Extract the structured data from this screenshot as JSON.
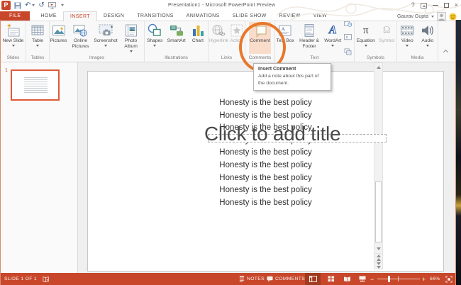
{
  "window": {
    "title": "Presentation1 - Microsoft PowerPoint Preview",
    "help_glyph": "?",
    "close_glyph": "×",
    "account_name": "Gaurav Gupta"
  },
  "tabs": [
    {
      "label": "FILE",
      "file": true
    },
    {
      "label": "HOME"
    },
    {
      "label": "INSERT",
      "active": true
    },
    {
      "label": "DESIGN"
    },
    {
      "label": "TRANSITIONS"
    },
    {
      "label": "ANIMATIONS"
    },
    {
      "label": "SLIDE SHOW"
    },
    {
      "label": "REVIEW"
    },
    {
      "label": "VIEW"
    }
  ],
  "ribbon": {
    "groups": [
      {
        "label": "Slides",
        "buttons": [
          {
            "label": "New Slide",
            "icon": "new-slide-icon",
            "dropdown": true
          }
        ]
      },
      {
        "label": "Tables",
        "buttons": [
          {
            "label": "Table",
            "icon": "table-icon",
            "dropdown": true
          }
        ]
      },
      {
        "label": "Images",
        "buttons": [
          {
            "label": "Pictures",
            "icon": "pictures-icon"
          },
          {
            "label": "Online Pictures",
            "icon": "online-pictures-icon"
          },
          {
            "label": "Screenshot",
            "icon": "screenshot-icon",
            "dropdown": true
          },
          {
            "label": "Photo Album",
            "icon": "photo-album-icon",
            "dropdown": true
          }
        ]
      },
      {
        "label": "Illustrations",
        "buttons": [
          {
            "label": "Shapes",
            "icon": "shapes-icon",
            "dropdown": true
          },
          {
            "label": "SmartArt",
            "icon": "smartart-icon"
          },
          {
            "label": "Chart",
            "icon": "chart-icon"
          }
        ]
      },
      {
        "label": "Links",
        "buttons": [
          {
            "label": "Hyperlink",
            "icon": "hyperlink-icon",
            "disabled": true
          },
          {
            "label": "Action",
            "icon": "action-icon",
            "disabled": true
          }
        ]
      },
      {
        "label": "Comments",
        "buttons": [
          {
            "label": "Comment",
            "icon": "comment-icon",
            "highlighted": true
          }
        ]
      },
      {
        "label": "Text",
        "buttons": [
          {
            "label": "Text Box",
            "icon": "text-box-icon"
          },
          {
            "label": "Header & Footer",
            "icon": "header-footer-icon"
          },
          {
            "label": "WordArt",
            "icon": "wordart-icon",
            "dropdown": true,
            "glyph": "A",
            "glyph_class": "glyph-wa"
          },
          {
            "stack": [
              "date-time-icon",
              "slide-number-icon",
              "object-icon"
            ]
          }
        ]
      },
      {
        "label": "Symbols",
        "buttons": [
          {
            "label": "Equation",
            "icon": "equation-icon",
            "dropdown": true,
            "glyph": "π",
            "glyph_class": "glyph-eq"
          },
          {
            "label": "Symbol",
            "icon": "symbol-icon",
            "disabled": true,
            "glyph": "Ω",
            "glyph_class": "glyph-sym"
          }
        ]
      },
      {
        "label": "Media",
        "buttons": [
          {
            "label": "Video",
            "icon": "video-icon",
            "dropdown": true
          },
          {
            "label": "Audio",
            "icon": "audio-icon",
            "dropdown": true
          }
        ]
      }
    ]
  },
  "tooltip": {
    "title": "Insert Comment",
    "body": "Add a note about this part of the document."
  },
  "slide": {
    "title_placeholder": "Click to add title",
    "body_lines": [
      "Honesty is the best policy",
      "Honesty is the best policy",
      "Honesty is the best policy",
      "Honesty is the best policy",
      "Honesty is the best policy",
      "Honesty is the best policy",
      "Honesty is the best policy",
      "Honesty is the best policy",
      "Honesty is the best policy"
    ]
  },
  "thumbnails": {
    "slide_number": "1"
  },
  "status": {
    "slide_indicator": "SLIDE 1 OF 1",
    "notes_label": "NOTES",
    "comments_label": "COMMENTS",
    "zoom_percent": "66%"
  },
  "colors": {
    "accent": "#C8472B",
    "comment_highlight": "#FADCCB",
    "annotation_ring": "#E8782A"
  }
}
